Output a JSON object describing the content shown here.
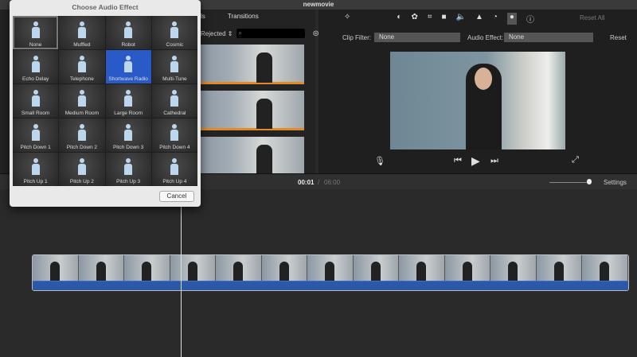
{
  "window": {
    "title": "newmovie"
  },
  "browser": {
    "tabs": [
      "ls",
      "Transitions"
    ],
    "filter": "Rejected ⇕",
    "search_placeholder": ""
  },
  "viewer": {
    "reset_all": "Reset All",
    "clip_filter_label": "Clip Filter:",
    "clip_filter_value": "None",
    "audio_effect_label": "Audio Effect:",
    "audio_effect_value": "None",
    "reset": "Reset"
  },
  "timeline": {
    "current_time": "00:01",
    "separator": "/",
    "total_time": "06:00",
    "settings": "Settings"
  },
  "dialog": {
    "title": "Choose Audio Effect",
    "cancel": "Cancel",
    "selected": "Shortwave Radio",
    "effects": [
      "None",
      "Muffled",
      "Robot",
      "Cosmic",
      "Echo Delay",
      "Telephone",
      "Shortwave Radio",
      "Multi-Tune",
      "Small Room",
      "Medium Room",
      "Large Room",
      "Cathedral",
      "Pitch Down 1",
      "Pitch Down 2",
      "Pitch Down 3",
      "Pitch Down 4",
      "Pitch Up 1",
      "Pitch Up 2",
      "Pitch Up 3",
      "Pitch Up 4"
    ]
  }
}
